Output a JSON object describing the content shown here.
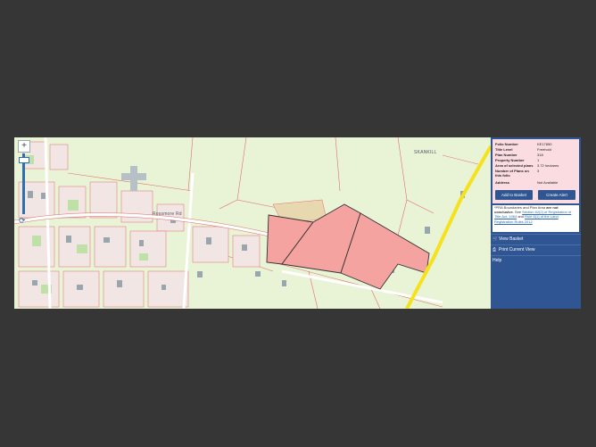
{
  "map": {
    "zoom_in_label": "+",
    "refresh_icon": "refresh-icon",
    "place_labels": [
      "SKANKILL",
      "Rossmore Rd"
    ],
    "colors": {
      "background": "#e9f3d6",
      "boundary": "#e07070",
      "selected_fill": "#f4a3a0",
      "road": "#f5e21a",
      "adjacent_fill": "#e8d8b0"
    }
  },
  "panel": {
    "fields": [
      {
        "label": "Folio Number",
        "value": "KE17850"
      },
      {
        "label": "Title Level",
        "value": "Freehold"
      },
      {
        "label": "Plan Number",
        "value": "318"
      },
      {
        "label": "Property Number",
        "value": "1"
      },
      {
        "label": "Area of selected plans",
        "value": "3.72 hectares"
      },
      {
        "label": "Number of Plans on this folio",
        "value": "3"
      },
      {
        "label": "Address",
        "value": "Not Available"
      }
    ],
    "add_to_basket": "Add to Basket",
    "create_alert": "Create Alert",
    "note": {
      "p1": "*PRA Boundaries and Plan Area",
      "bold": "are not conclusive",
      "p2": ". See",
      "link1": "Section 62(2) of Registration of Title Act, 1964",
      "p3": "and",
      "link2": "Rule 8(1) of the Land Registration Rules 2012"
    },
    "menu": {
      "view_basket": "View Basket",
      "print_view": "Print Current View",
      "help": "Help"
    },
    "colors": {
      "panel_bg": "#2f5592",
      "info_bg": "#fbdde1"
    }
  }
}
